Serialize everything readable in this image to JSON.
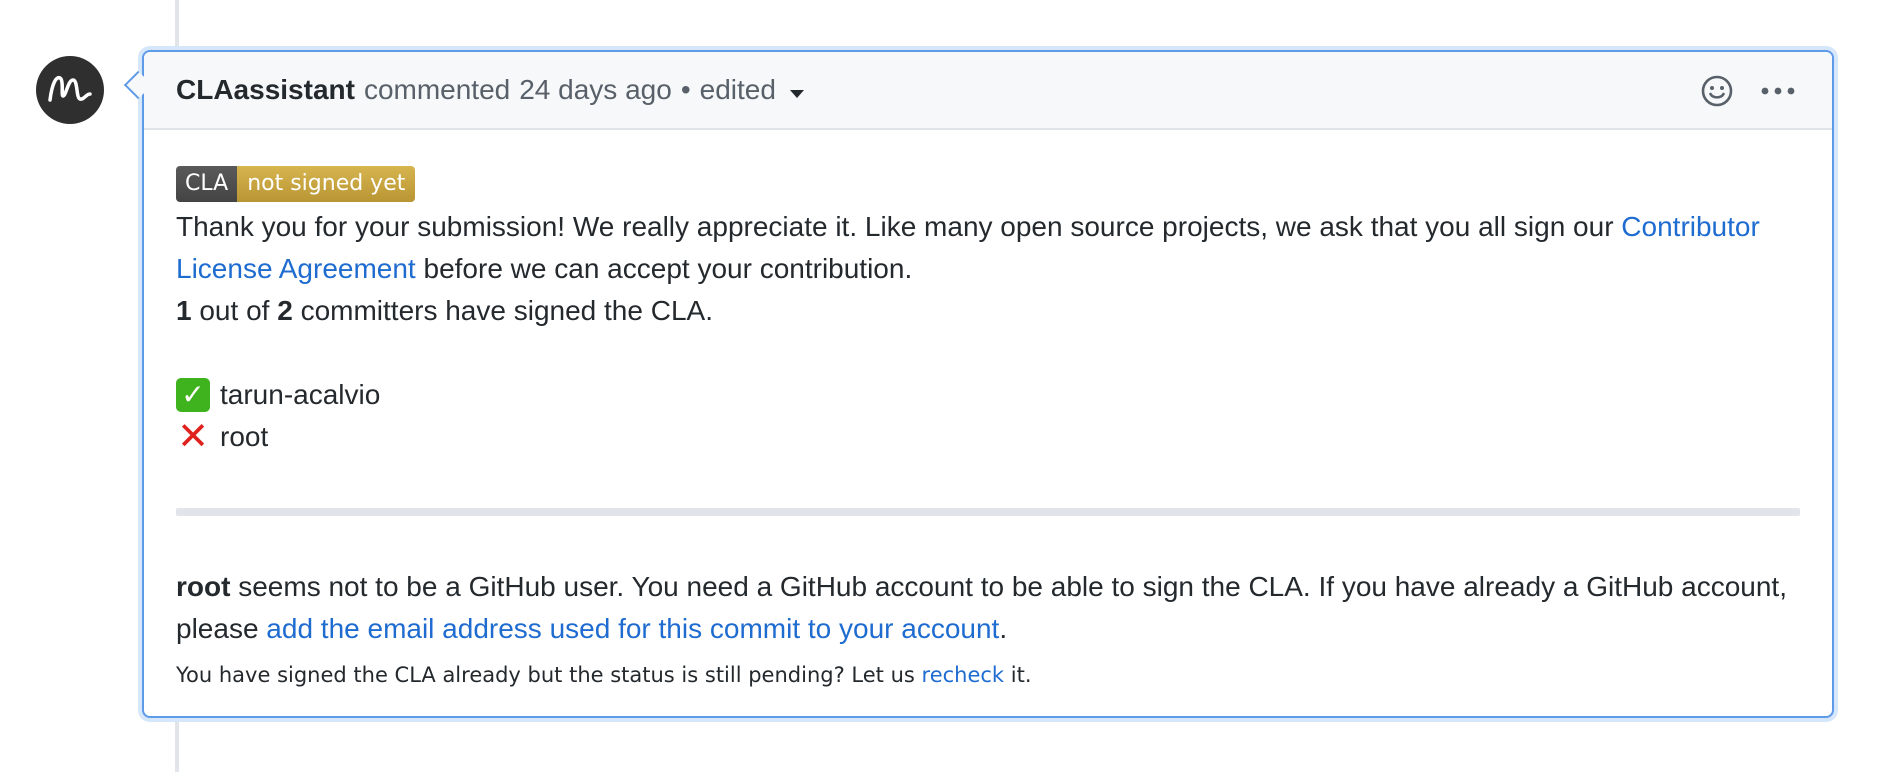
{
  "comment": {
    "author": "CLAassistant",
    "action": "commented",
    "time": "24 days ago",
    "separator": "•",
    "edited": "edited"
  },
  "badge": {
    "left": "CLA",
    "right": "not signed yet"
  },
  "body": {
    "intro_text": "Thank you for your submission! We really appreciate it. Like many open source projects, we ask that you all sign our",
    "agreement_link": "Contributor License Agreement",
    "intro_suffix": "before we can accept your contribution.",
    "signed_count": "1",
    "out_of": "out of",
    "total_count": "2",
    "count_suffix": "committers have signed the CLA.",
    "signers": [
      {
        "status": "signed",
        "name": "tarun-acalvio"
      },
      {
        "status": "not-signed",
        "name": "root"
      }
    ],
    "notice_user": "root",
    "notice_text": "seems not to be a GitHub user. You need a GitHub account to be able to sign the CLA. If you have already a GitHub account, please",
    "notice_link": "add the email address used for this commit to your account",
    "notice_end": ".",
    "pending_text": "You have signed the CLA already but the status is still pending? Let us",
    "recheck_link": "recheck",
    "pending_end": "it."
  },
  "icons": {
    "avatar": "claassistant-avatar",
    "reaction": "smiley-icon",
    "more": "kebab-horizontal-icon",
    "signed": "check-mark-icon",
    "not_signed": "cross-mark-icon"
  },
  "colors": {
    "link": "#1f6cd1",
    "border_active": "#5d9ae8",
    "badge_dark": "#4f4f4f",
    "badge_gold": "#c9a642"
  }
}
